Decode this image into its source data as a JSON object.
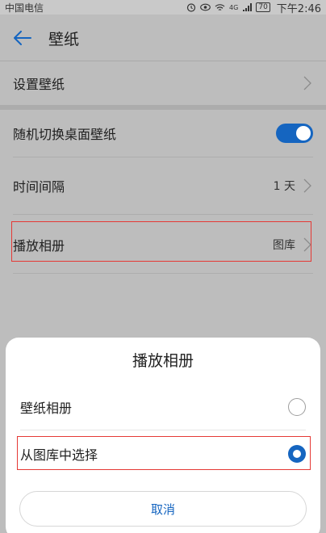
{
  "status_bar": {
    "carrier": "中国电信",
    "signal_text": "4G",
    "battery": "70",
    "time": "下午2:46"
  },
  "header": {
    "title": "壁纸"
  },
  "settings": {
    "set_wallpaper": "设置壁纸",
    "random_switch": "随机切换桌面壁纸",
    "random_switch_on": true,
    "interval_label": "时间间隔",
    "interval_value": "1 天",
    "album_label": "播放相册",
    "album_value": "图库"
  },
  "sheet": {
    "title": "播放相册",
    "options": [
      {
        "label": "壁纸相册",
        "selected": false
      },
      {
        "label": "从图库中选择",
        "selected": true
      }
    ],
    "cancel_label": "取消"
  },
  "colors": {
    "accent": "#1565c0",
    "highlight_box": "#e53935"
  }
}
